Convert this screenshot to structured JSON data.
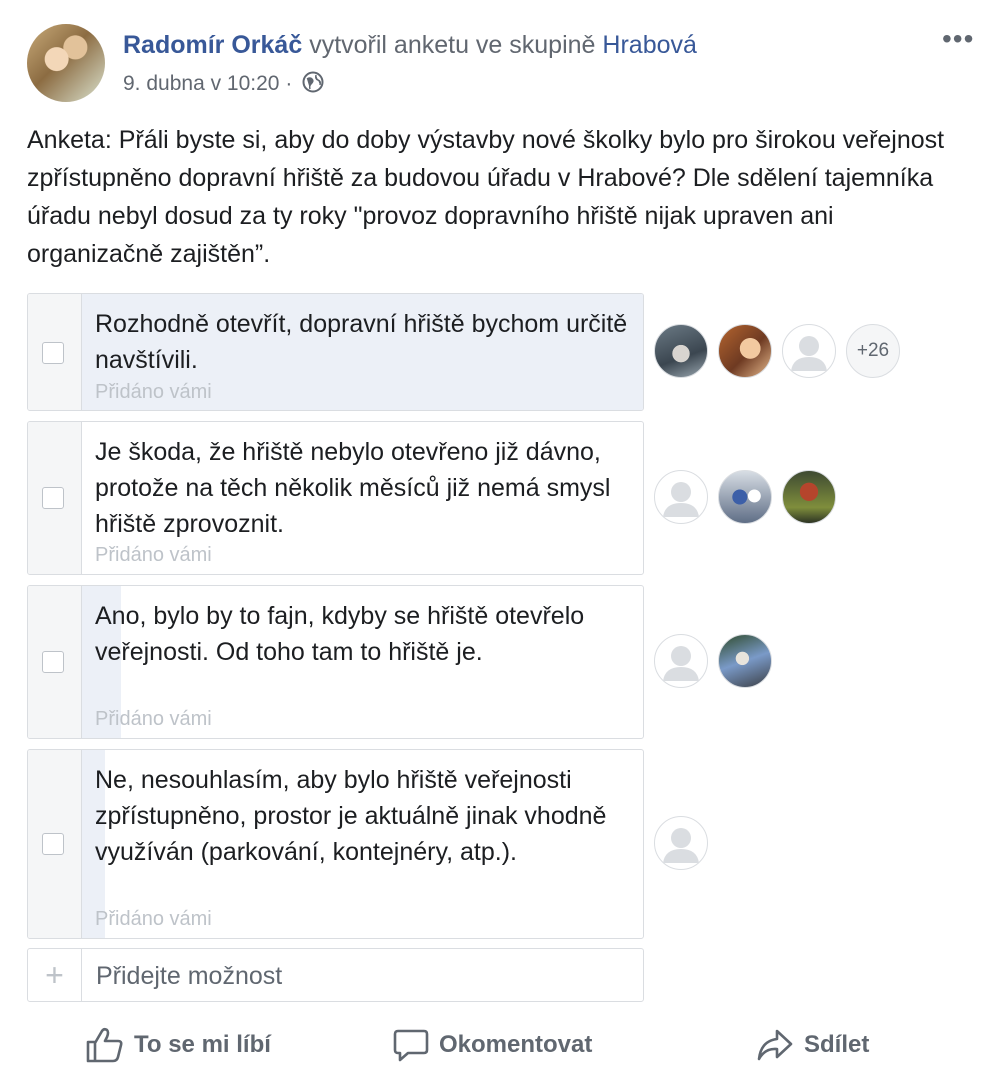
{
  "header": {
    "author": "Radomír Orkáč",
    "action_text": " vytvořil anketu ve skupině ",
    "group": "Hrabová",
    "date": "9. dubna v 10:20",
    "separator": "·",
    "privacy_icon": "globe-icon",
    "more_icon": "more-options-icon",
    "more_glyph": "•••"
  },
  "post_text": "Anketa: Přáli byste si, aby do doby výstavby nové školky bylo pro širokou veřejnost zpřístupněno dopravní hřiště za budovou úřadu v Hrabové? Dle sdělení tajemníka úřadu nebyl dosud za ty roky \"provoz dopravního hřiště nijak upraven ani organizačně zajištěn”.",
  "poll": {
    "options": [
      {
        "text": "Rozhodně otevřít, dopravní hřiště bychom určitě navštívili.",
        "added_by": "Přidáno vámi",
        "vote_share": 1.0,
        "voters": [
          "photo",
          "photo",
          "default"
        ],
        "more_count": "+26"
      },
      {
        "text": "Je škoda, že hřiště nebylo otevřeno již dávno, protože na těch několik měsíců již nemá smysl hřiště zprovoznit.",
        "added_by": "Přidáno vámi",
        "vote_share": 0.0,
        "voters": [
          "default",
          "photo",
          "photo"
        ],
        "more_count": ""
      },
      {
        "text": "Ano, bylo by to fajn, kdyby se hřiště otevřelo veřejnosti. Od toho tam to hřiště je.",
        "added_by": "Přidáno vámi",
        "vote_share": 0.07,
        "voters": [
          "default",
          "photo"
        ],
        "more_count": ""
      },
      {
        "text": "Ne, nesouhlasím, aby bylo hřiště veřejnosti zpřístupněno, prostor je aktuálně jinak vhodně využíván (parkování, kontejnéry, atp.).",
        "added_by": "Přidáno vámi",
        "vote_share": 0.04,
        "voters": [
          "default"
        ],
        "more_count": ""
      }
    ],
    "add_option_placeholder": "Přidejte možnost",
    "add_icon": "+"
  },
  "actions": {
    "like": "To se mi líbí",
    "comment": "Okomentovat",
    "share": "Sdílet"
  },
  "colors": {
    "link": "#385898",
    "secondary_text": "#606770",
    "border": "#dadde1",
    "poll_fill": "#ecf0f7"
  }
}
